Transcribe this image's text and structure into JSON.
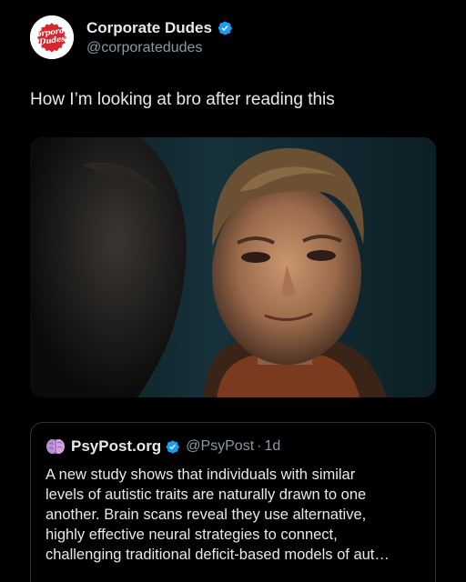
{
  "post": {
    "author_name": "Corporate Dudes",
    "handle": "@corporatedudes",
    "avatar_text_line1": "Corporate",
    "avatar_text_line2": "Dudes",
    "text": "How I’m looking at bro after reading this",
    "verified_icon": "verified-badge-icon",
    "brand_color": "#d8262e"
  },
  "quote": {
    "source_name": "PsyPost.org",
    "handle": "@PsyPost",
    "separator": "·",
    "time": "1d",
    "icon": "brain-icon",
    "body_lines": [
      "A new study shows that individuals with similar",
      "levels of autistic traits are naturally drawn to one",
      "another. Brain scans reveal they use alternative,",
      "highly effective neural strategies to connect,",
      "challenging traditional deficit-based models of aut…"
    ]
  },
  "colors": {
    "background": "#000000",
    "text": "#e7e9ea",
    "muted": "#8b98a5",
    "verified": "#1d9bf0",
    "border": "#2f3336"
  }
}
